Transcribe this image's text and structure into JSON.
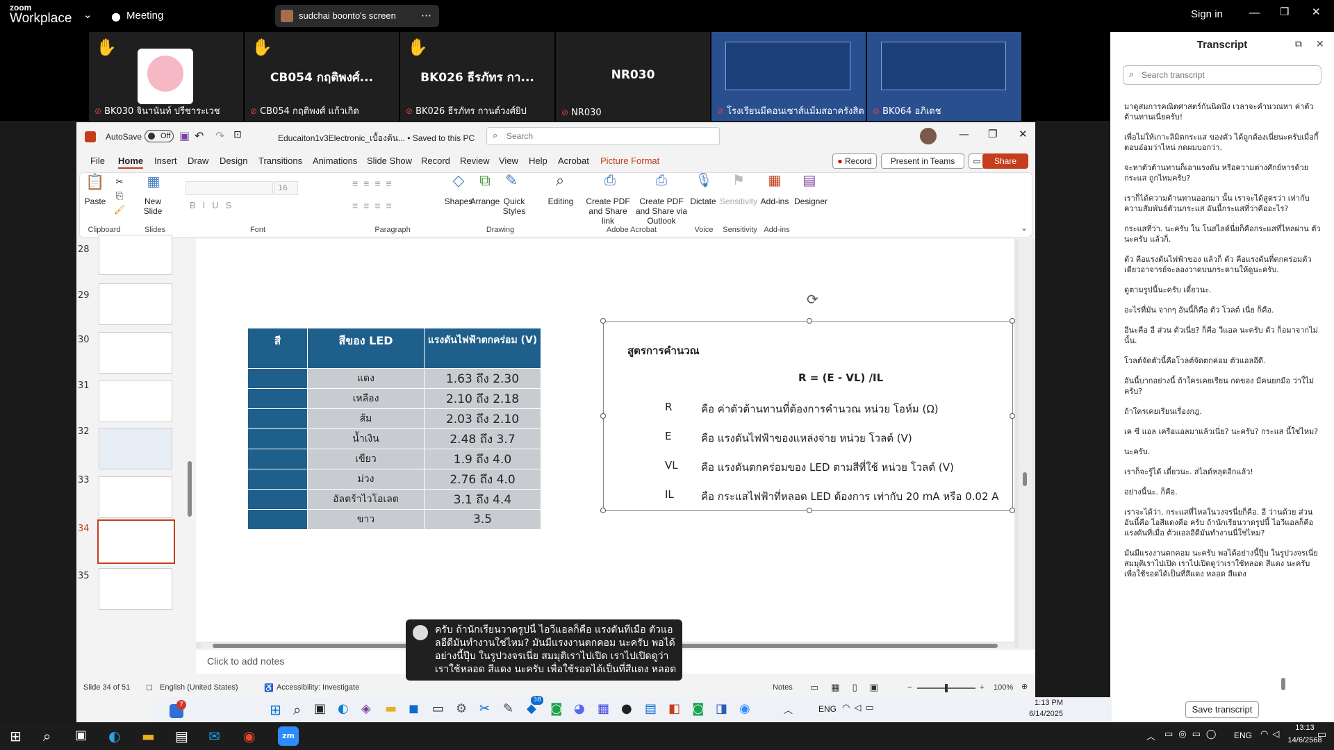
{
  "zoom": {
    "brand_top": "zoom",
    "brand": "Workplace",
    "meeting_label": "Meeting",
    "share_label": "sudchai boonto's screen",
    "sign_in": "Sign in"
  },
  "gallery": [
    {
      "name": "BK030 จินานันท์ ปรีชาระเวช",
      "big": "",
      "hand": true
    },
    {
      "name": "CB054 กฤติพงศ์ แก้วเกิด",
      "big": "CB054 กฤติพงศ์...",
      "hand": true
    },
    {
      "name": "BK026 ธีรภัทร กานต์วงศ์ยิป",
      "big": "BK026 ธีรภัทร กา...",
      "hand": true
    },
    {
      "name": "NR030",
      "big": "NR030",
      "hand": false
    },
    {
      "name": "โรงเรียนมีคอนเซาส์แม้มสอาครังสิต",
      "big": "",
      "hand": false
    },
    {
      "name": "BK064 อภิเดช",
      "big": "",
      "hand": false
    }
  ],
  "transcript": {
    "title": "Transcript",
    "search_placeholder": "Search transcript",
    "lines": [
      "มาดูสมการคณิตศาสตร์กันนิดนึง เวลาจะคำนวณหา ค่าตัวต้านทานเนี่ยครับ!",
      "เพื่อไม่ให้เกาะลิมิตกระแส ของตัว ได้ถูกต้องเนี่ยนะครับเมื่อกี้ตอบอ๋อมว่าไหน่ กดผมบอกว่า.",
      "จะหาตัวต้านทานก็เอาแรงดัน หรือความต่างศักย์หารด้วยกระแส ถูกไหมครับ?",
      "เราก็ได้ความต้านทานออกมา นั้น เราจะได้สูตรว่า เท่ากับความสัมพันธ์ตัวนกระแส อันนี้กระแสที่ว่าคืออะไร?",
      "กระแสที่ว่า. นะครับ ใน โนสไลด์นี่ยก็คือกระแสที่ไหลผ่าน ตัว นะครับ แล้วก็.",
      "ตัว คือแรงดันไฟฟ้าของ แล้วก็ ตัว คือแรงดันที่ตกคร่อมตัวเดียวอาจารย์จะลองวาดบนกระดานให้ดูนะครับ.",
      "ดูตามรูปนี้นะครับ เดี๋ยวนะ.",
      "อะไรที่มัน จากๆ อันนี้ก็คือ ตัว โวลต์ เนี่ย ก็คือ.",
      "อีนะคือ อี ส่วน ตัวเนี่ย? ก็คือ วีแอล นะครับ ตัว ก็อมาจากไม่นั้น.",
      "โวลต์จัดตัวนี้คือโวลต์จัดตกค่อม ตัวแอลอีดี.",
      "อันนี้บากอย่างนี้ ถ้าใครเคยเรียน กดของ มีคนยกมือ ว่าใ่ไม่ครับ?",
      "ถ้าใครเคยเรียนเรื่องกฎ.",
      "เค ซี แอล เครือแอลมาแล้วเนี่ย? นะครับ? กระแส นี้ใช่ไหม?",
      "นะครับ.",
      "เราก็จะรู้ได้ เดี๋ยวนะ. สไลด์หลุดอีกแล้ว!",
      "อย่างนี้นะ. ก็คือ.",
      "เราจะได้ว่า. กระแสที่ไหลในวงจรนี่ยก็คือ. อี ว่านด้วย ส่วน อันนี้คือ ไอสีแดงคือ ครับ ถ้านักเรียนวาดรูปนี้ ไอวีแอลก็คือ แรงดันที่เมื่อ ตัวแอลอีดีมันทำงานนี่ใช่ไหม?",
      "มันมีแรงงานตกคอม นะครับ พอได้อย่างนี้ปุ๊บ ในรูปวงจรเนี่ย สมมุติเราไปเปิด เราไปเปิดดูว่าเราใช้หลอด สีแดง นะครับ เพื่อใช้รอดได้เป็นที่สีแดง หลอด สีแดง"
    ],
    "save_button": "Save transcript"
  },
  "ppt": {
    "autosave": "AutoSave",
    "autosave_state": "Off",
    "file_title": "Educaiton1v3Electronic_เบื้องต้น... • Saved to this PC",
    "search_placeholder": "Search",
    "tabs": [
      "File",
      "Home",
      "Insert",
      "Draw",
      "Design",
      "Transitions",
      "Animations",
      "Slide Show",
      "Record",
      "Review",
      "View",
      "Help",
      "Acrobat",
      "Picture Format"
    ],
    "record_btn": "Record",
    "present_btn": "Present in Teams",
    "share_btn": "Share",
    "ribbon": {
      "paste": "Paste",
      "new_slide": "New Slide",
      "shapes": "Shapes",
      "arrange": "Arrange",
      "quick_styles": "Quick Styles",
      "editing": "Editing",
      "create_pdf_link": "Create PDF and Share link",
      "create_pdf_outlook": "Create PDF and Share via Outlook",
      "dictate": "Dictate",
      "sensitivity": "Sensitivity",
      "addins": "Add-ins",
      "designer": "Designer",
      "font_size": "16",
      "groups": [
        "Clipboard",
        "Slides",
        "Font",
        "Paragraph",
        "Drawing",
        "Adobe Acrobat",
        "Voice",
        "Sensitivity",
        "Add-ins"
      ]
    },
    "thumb_numbers": [
      "28",
      "29",
      "30",
      "31",
      "32",
      "33",
      "34",
      "35"
    ],
    "table": {
      "headers": [
        "สี",
        "สีของ LED",
        "แรงดันไฟฟ้าตกคร่อม (V)"
      ],
      "rows": [
        [
          "แดง",
          "1.63 ถึง 2.30"
        ],
        [
          "เหลือง",
          "2.10 ถึง 2.18"
        ],
        [
          "ส้ม",
          "2.03 ถึง 2.10"
        ],
        [
          "น้ำเงิน",
          "2.48 ถึง 3.7"
        ],
        [
          "เขียว",
          "1.9 ถึง 4.0"
        ],
        [
          "ม่วง",
          "2.76 ถึง 4.0"
        ],
        [
          "อัลตร้าไวโอเลต",
          "3.1 ถึง 4.4"
        ],
        [
          "ขาว",
          "3.5"
        ]
      ]
    },
    "formula_box": {
      "title": "สูตรการคำนวณ",
      "formula": "R = (E - VL) /IL",
      "defs": [
        {
          "sym": "R",
          "text": "คือ ค่าตัวต้านทานที่ต้องการคำนวณ หน่วย โอห์ม (Ω)"
        },
        {
          "sym": "E",
          "text": "คือ แรงดันไฟฟ้าของแหล่งจ่าย หน่วย โวลต์ (V)"
        },
        {
          "sym": "VL",
          "text": "คือ แรงดันตกคร่อมของ LED ตามสีที่ใช้ หน่วย โวลต์ (V)"
        },
        {
          "sym": "IL",
          "text": "คือ กระแสไฟฟ้าที่หลอด LED ต้องการ เท่ากับ 20 mA หรือ 0.02 A"
        }
      ]
    },
    "notes_placeholder": "Click to add notes",
    "status": {
      "slide_of": "Slide 34 of 51",
      "language": "English (United States)",
      "accessibility": "Accessibility: Investigate",
      "notes": "Notes",
      "zoom": "100%"
    }
  },
  "caption": "ครับ ถ้านักเรียนวาดรูปนี้ ไอวีแอลก็คือ แรงดันที่เมื่อ ตัวแอลอีดีมันทำงานใช่ไหม? มันมีแรงงานตกคอม นะครับ พอได้อย่างนี้ปุ๊บ ในรูปวงจรเนี่ย สมมุติเราไปเปิด เราไปเปิดดูว่าเราใช้หลอด สีแดง นะครับ เพื่อใช้รอดได้เป็นที่สีแดง หลอด",
  "inner_taskbar": {
    "time": "1:13 PM",
    "date": "6/14/2025",
    "lang": "ENG",
    "badge_notif": "7",
    "badge_38": "38"
  },
  "outer_taskbar": {
    "time": "13:13",
    "date": "14/6/2568",
    "lang": "ENG"
  }
}
